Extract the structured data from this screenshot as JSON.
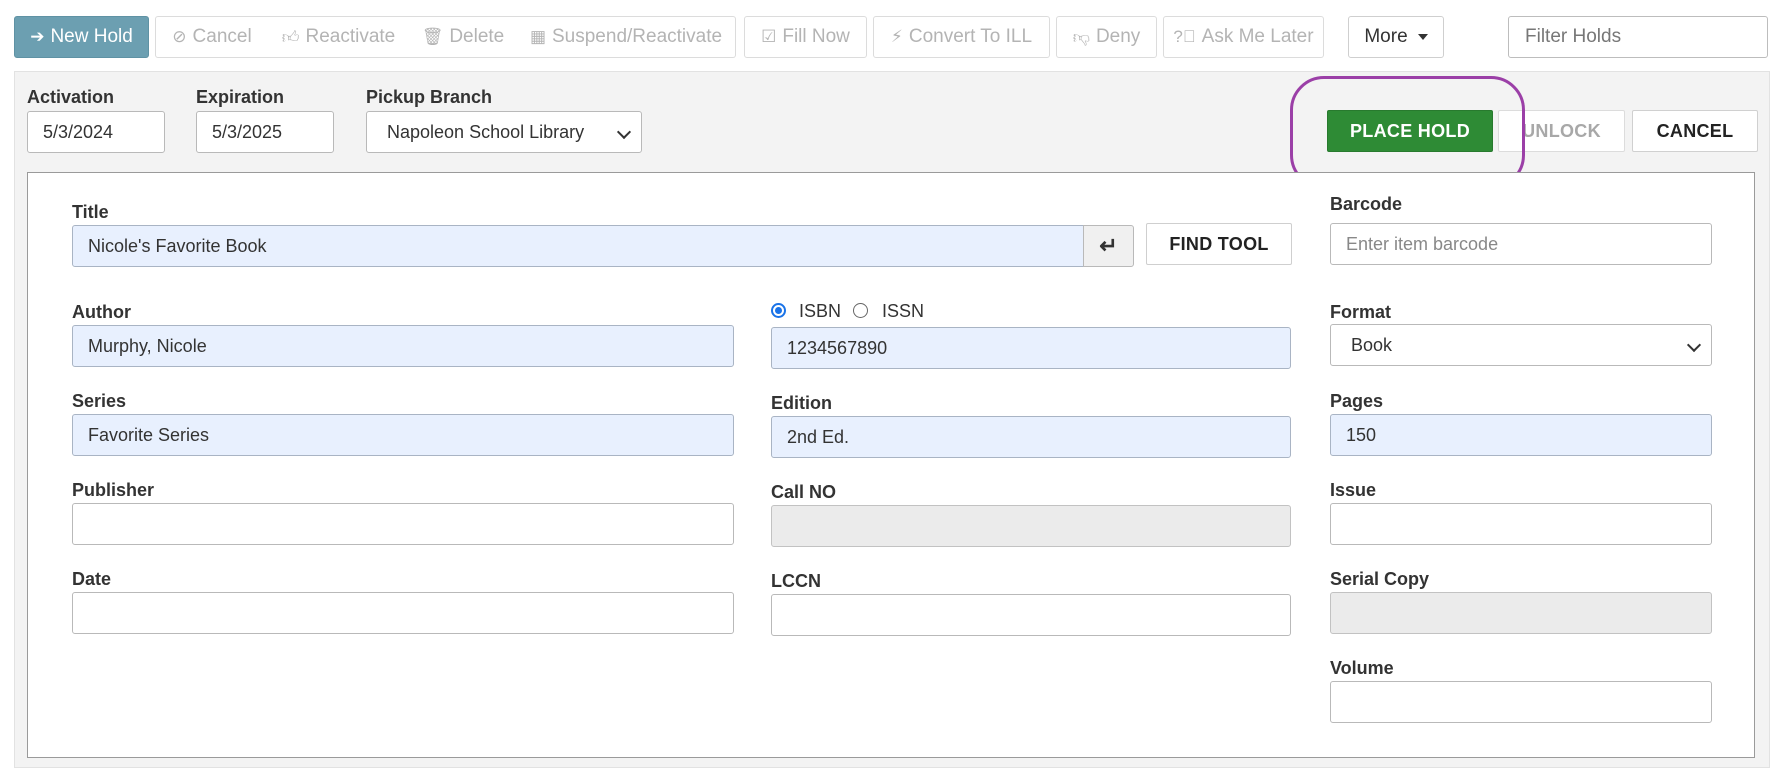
{
  "toolbar": {
    "new_hold": "New Hold",
    "cancel": "Cancel",
    "reactivate": "Reactivate",
    "delete": "Delete",
    "suspend_reactivate": "Suspend/Reactivate",
    "fill_now": "Fill Now",
    "convert_to_ill": "Convert To ILL",
    "deny": "Deny",
    "ask_me_later": "Ask Me Later",
    "more": "More",
    "filter_placeholder": "Filter Holds",
    "icons": [
      "sign-in-icon",
      "ban-icon",
      "thumbs-up-icon",
      "trash-icon",
      "calendar-icon",
      "check-square-icon",
      "bolt-icon",
      "thumbs-down-icon",
      "question-circle-icon",
      "caret-down-icon"
    ]
  },
  "hold": {
    "activation_label": "Activation",
    "activation_value": "5/3/2024",
    "expiration_label": "Expiration",
    "expiration_value": "5/3/2025",
    "pickup_branch_label": "Pickup Branch",
    "pickup_branch_value": "Napoleon School Library",
    "place_hold": "PLACE HOLD",
    "unlock": "UNLOCK",
    "cancel": "CANCEL"
  },
  "form": {
    "title_label": "Title",
    "title_value": "Nicole's Favorite Book",
    "find_tool": "FIND TOOL",
    "barcode_label": "Barcode",
    "barcode_placeholder": "Enter item barcode",
    "author_label": "Author",
    "author_value": "Murphy, Nicole",
    "isbn_label": "ISBN",
    "issn_label": "ISSN",
    "isbn_value": "1234567890",
    "format_label": "Format",
    "format_value": "Book",
    "series_label": "Series",
    "series_value": "Favorite Series",
    "edition_label": "Edition",
    "edition_value": "2nd Ed.",
    "pages_label": "Pages",
    "pages_value": "150",
    "publisher_label": "Publisher",
    "publisher_value": "",
    "call_no_label": "Call NO",
    "call_no_value": "",
    "issue_label": "Issue",
    "issue_value": "",
    "date_label": "Date",
    "date_value": "",
    "lccn_label": "LCCN",
    "lccn_value": "",
    "serial_copy_label": "Serial Copy",
    "serial_copy_value": "",
    "volume_label": "Volume",
    "volume_value": ""
  },
  "colors": {
    "primary": "#6c9fb1",
    "place_hold": "#2e8b35",
    "highlight": "#9b3fa7",
    "filled_input": "#e8f0fe"
  }
}
